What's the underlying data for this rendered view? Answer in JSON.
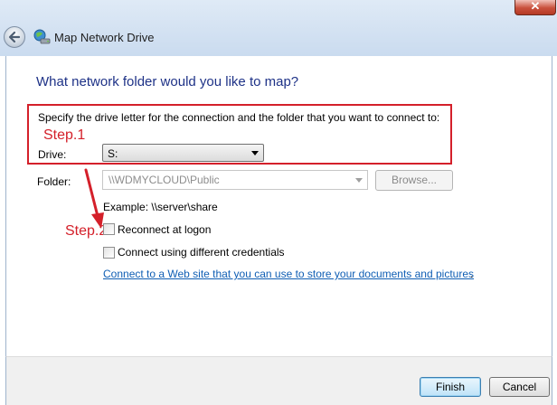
{
  "window": {
    "title": "Map Network Drive",
    "close_symbol": "✕"
  },
  "main": {
    "heading": "What network folder would you like to map?",
    "instruction": "Specify the drive letter for the connection and the folder that you want to connect to:"
  },
  "drive": {
    "label": "Drive:",
    "value": "S:"
  },
  "folder": {
    "label": "Folder:",
    "value": "\\\\WDMYCLOUD\\Public",
    "browse_label": "Browse...",
    "example": "Example: \\\\server\\share"
  },
  "options": {
    "reconnect_label": "Reconnect at logon",
    "reconnect_checked": false,
    "credentials_label": "Connect using different credentials",
    "credentials_checked": false,
    "web_link": "Connect to a Web site that you can use to store your documents and pictures",
    "web_link_suffix": "."
  },
  "annotations": {
    "step1": "Step.1",
    "step2": "Step.2",
    "color": "#d4202a"
  },
  "footer": {
    "finish_label": "Finish",
    "cancel_label": "Cancel"
  },
  "icons": {
    "back": "back-arrow-icon",
    "app": "network-drive-icon",
    "close": "close-icon"
  }
}
